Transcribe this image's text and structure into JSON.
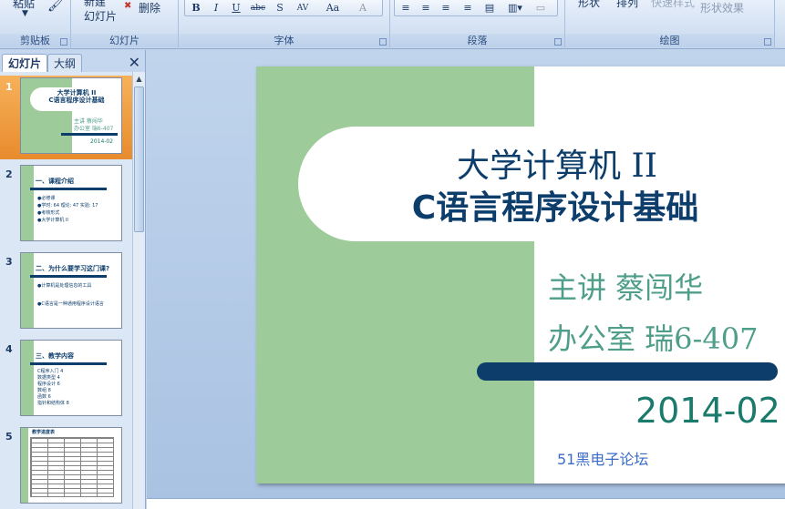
{
  "ribbon": {
    "clipboard": {
      "paste_label": "粘贴",
      "group_label": "剪贴板"
    },
    "slides": {
      "new_slide_label": "新建\n幻灯片",
      "delete_label": "删除",
      "group_label": "幻灯片"
    },
    "font": {
      "group_label": "字体",
      "buttons": [
        "B",
        "I",
        "U",
        "abc",
        "S",
        "AV",
        "Aa",
        "A"
      ]
    },
    "paragraph": {
      "group_label": "段落"
    },
    "drawing": {
      "shapes_label": "形状",
      "arrange_label": "排列",
      "quick_styles_label": "快速样式",
      "shape_effects_label": "形状效果",
      "group_label": "绘图"
    }
  },
  "pane": {
    "tabs": [
      {
        "label": "幻灯片",
        "active": true
      },
      {
        "label": "大纲",
        "active": false
      }
    ],
    "close_glyph": "✕",
    "thumbnails": [
      {
        "number": "1",
        "title": "大学计算机 II\nC语言程序设计基础",
        "lines": [
          "主讲 蔡闯华",
          "办公室 瑞6-407",
          "2014-02"
        ]
      },
      {
        "number": "2",
        "title": "一、课程介绍",
        "lines": [
          "●必修课",
          "●学时: 64    理论: 47    实验: 17",
          "●考核形式",
          "●大学计算机 II"
        ]
      },
      {
        "number": "3",
        "title": "二、为什么要学习这门课?",
        "lines": [
          "●计算机是处理信息的工具",
          "●C语言是一种通用程序设计语言"
        ]
      },
      {
        "number": "4",
        "title": "三、教学内容",
        "lines": [
          "C程序入门 4",
          "数据类型 4",
          "程序设计 6",
          "数组 8",
          "函数 6",
          "指针和结构体 8"
        ]
      },
      {
        "number": "5",
        "title": "教学进度表",
        "lines": []
      }
    ]
  },
  "slide": {
    "title_line1": "大学计算机 II",
    "title_line2": "C语言程序设计基础",
    "presenter": "主讲  蔡闯华",
    "office": "办公室 瑞6-407",
    "date": "2014-02",
    "forum": "51黑电子论坛"
  },
  "colors": {
    "slide_green": "#9dcb9a",
    "navy": "#0c3d6b",
    "teal_text": "#4f9e8a",
    "date_teal": "#1a7a6c",
    "selected_thumb": "#e88b2d"
  }
}
